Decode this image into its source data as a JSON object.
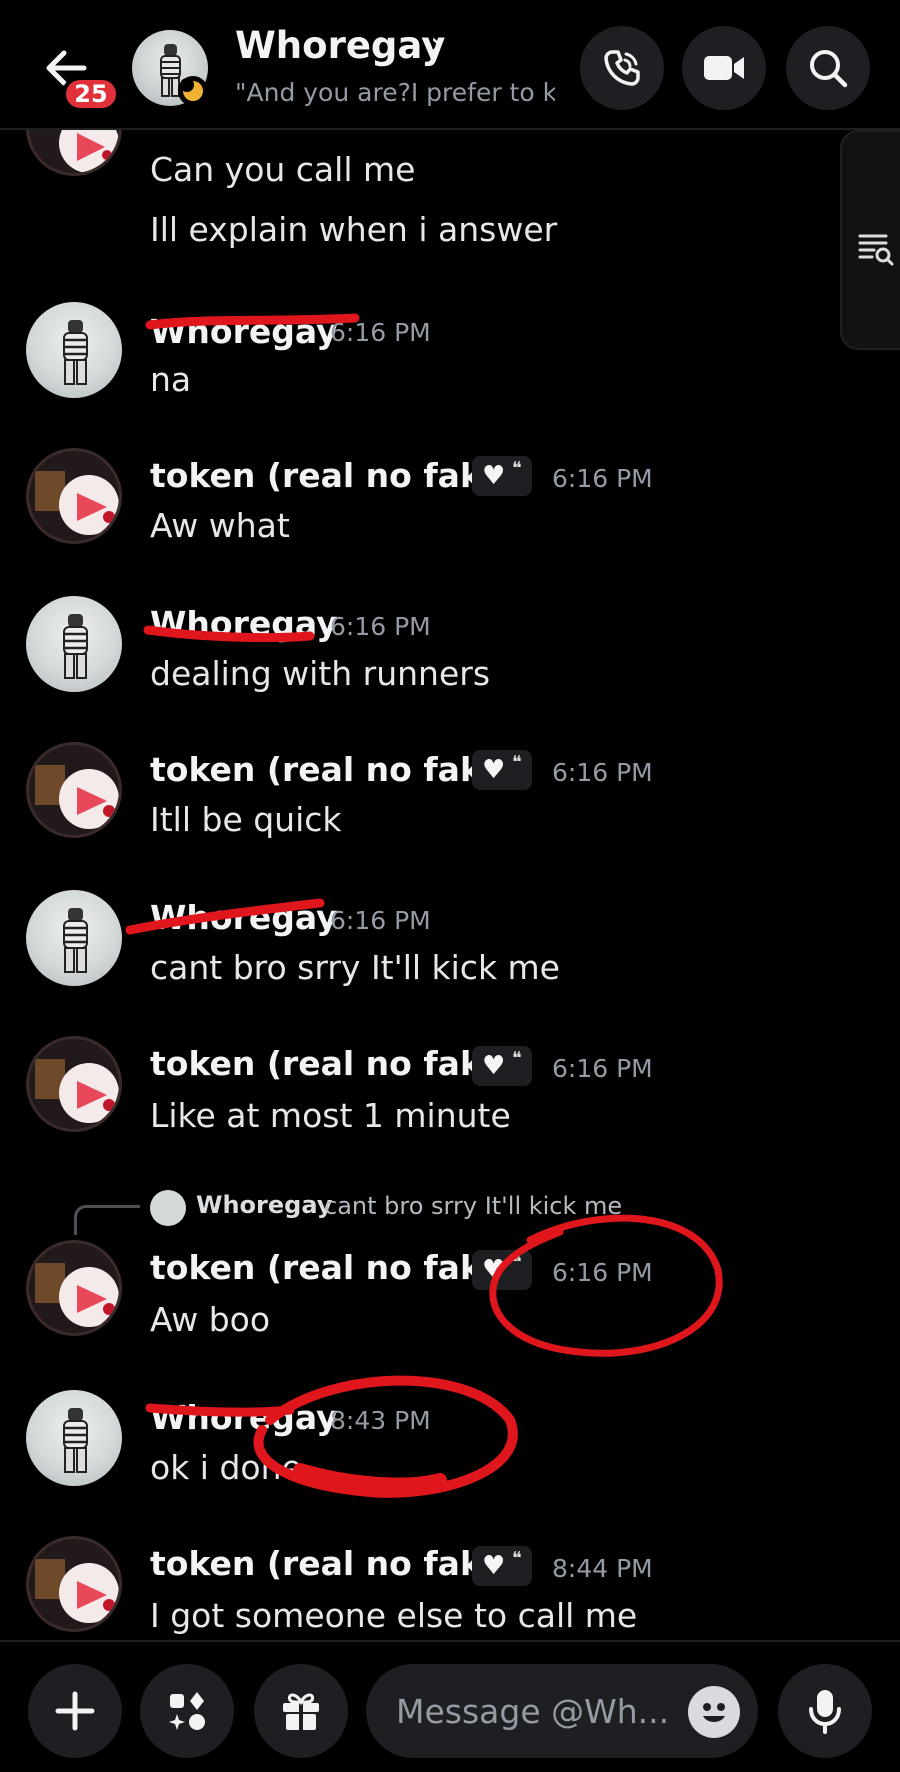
{
  "header": {
    "unread_count": "25",
    "name": "Whoregay",
    "chevron": "›",
    "status_text": "\"And you are?I prefer to k..."
  },
  "messages": [
    {
      "text": "Can you call me"
    },
    {
      "text": "Ill explain when i answer"
    },
    {
      "author": "Whoregay",
      "time": "6:16 PM",
      "text": "na"
    },
    {
      "author": "token (real no fake)",
      "time": "6:16 PM",
      "text": "Aw what"
    },
    {
      "author": "Whoregay",
      "time": "6:16 PM",
      "text": "dealing with runners"
    },
    {
      "author": "token (real no fake)",
      "time": "6:16 PM",
      "text": "Itll be quick"
    },
    {
      "author": "Whoregay",
      "time": "6:16 PM",
      "text": "cant bro srry It'll kick me"
    },
    {
      "author": "token (real no fake)",
      "time": "6:16 PM",
      "text": "Like at most 1 minute"
    },
    {
      "author": "token (real no fake)",
      "time": "6:16 PM",
      "text": "Aw boo",
      "reply": {
        "author": "Whoregay",
        "text": "cant bro srry It'll kick me"
      }
    },
    {
      "author": "Whoregay",
      "time": "8:43 PM",
      "text": "ok i done"
    },
    {
      "author": "token (real no fake)",
      "time": "8:44 PM",
      "text": "I got someone else to call me"
    }
  ],
  "composer": {
    "placeholder": "Message @Wh..."
  },
  "colors": {
    "background": "#000000",
    "surface": "#1e1f22",
    "badge": "#e0313a",
    "idle_status": "#f0b232",
    "annotation_red": "#e0161d",
    "timestamp": "#949ba4"
  },
  "icons": {
    "back": "arrow-left-icon",
    "call": "phone-icon",
    "video": "video-camera-icon",
    "search": "search-icon",
    "threads": "list-search-icon",
    "add": "plus-icon",
    "apps": "apps-icon",
    "gift": "gift-icon",
    "emoji": "emoji-icon",
    "mic": "microphone-icon"
  }
}
